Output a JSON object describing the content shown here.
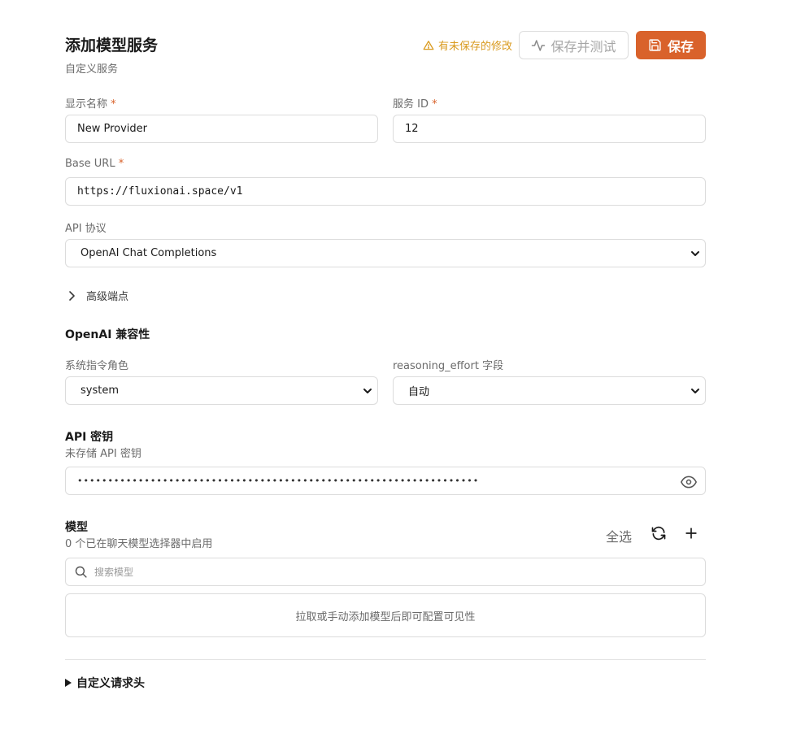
{
  "header": {
    "title": "添加模型服务",
    "subtitle": "自定义服务",
    "unsaved_notice": "有未保存的修改",
    "save_test_label": "保存并测试",
    "save_label": "保存"
  },
  "form": {
    "display_name": {
      "label": "显示名称",
      "required": "*",
      "value": "New Provider"
    },
    "service_id": {
      "label": "服务 ID",
      "required": "*",
      "value": "12"
    },
    "base_url": {
      "label": "Base URL",
      "required": "*",
      "value": "https://fluxionai.space/v1"
    },
    "api_protocol": {
      "label": "API 协议",
      "value": "OpenAI Chat Completions"
    }
  },
  "advanced_endpoints": {
    "label": "高级端点"
  },
  "compat": {
    "heading": "OpenAI 兼容性",
    "system_role": {
      "label": "系统指令角色",
      "value": "system"
    },
    "reasoning_effort": {
      "label": "reasoning_effort 字段",
      "value": "自动"
    }
  },
  "api_key": {
    "heading": "API 密钥",
    "subtitle": "未存储 API 密钥",
    "masked_value": "••••••••••••••••••••••••••••••••••••••••••••••••••••••••••••••••••"
  },
  "models": {
    "heading": "模型",
    "subtitle": "0 个已在聊天模型选择器中启用",
    "select_all_label": "全选",
    "search_placeholder": "搜索模型",
    "empty_text": "拉取或手动添加模型后即可配置可见性"
  },
  "custom_headers": {
    "label": "自定义请求头"
  },
  "colors": {
    "accent": "#d9622b",
    "warning": "#d99a1e",
    "border": "#dcdcdc"
  }
}
